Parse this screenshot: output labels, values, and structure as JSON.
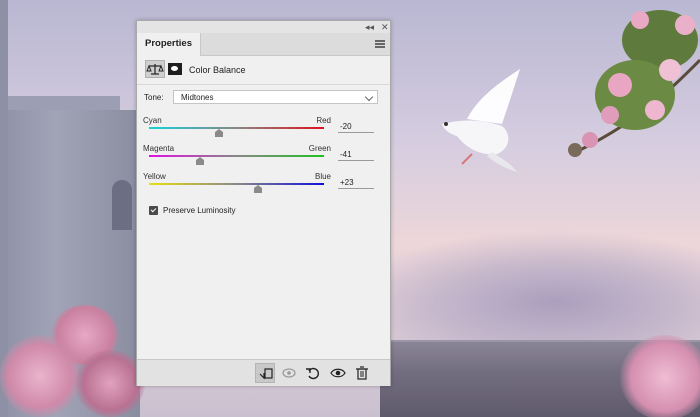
{
  "panel": {
    "tab_label": "Properties",
    "adjustment_title": "Color Balance",
    "tone": {
      "label": "Tone:",
      "selected": "Midtones"
    },
    "sliders": [
      {
        "left_label": "Cyan",
        "right_label": "Red",
        "value": "-20",
        "gradient": [
          "#16d1d6",
          "#e0101a"
        ],
        "position": 0.4
      },
      {
        "left_label": "Magenta",
        "right_label": "Green",
        "value": "-41",
        "gradient": [
          "#e010e0",
          "#20c020"
        ],
        "position": 0.29
      },
      {
        "left_label": "Yellow",
        "right_label": "Blue",
        "value": "+23",
        "gradient": [
          "#e8e010",
          "#1010d8"
        ],
        "position": 0.62
      }
    ],
    "preserve_luminosity": {
      "label": "Preserve Luminosity",
      "checked": true
    },
    "footer_icons": [
      "clip-to-layer-icon",
      "view-previous-state-icon",
      "reset-icon",
      "visibility-eye-icon",
      "trash-icon"
    ],
    "titlebar_icons": [
      "collapse-icon",
      "close-icon"
    ]
  }
}
